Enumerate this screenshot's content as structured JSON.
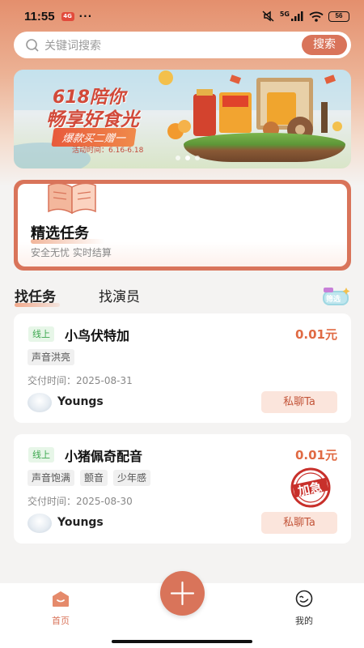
{
  "status_bar": {
    "time": "11:55",
    "app_badge": "4G",
    "dots": "···",
    "network": "5G",
    "battery": "56"
  },
  "search": {
    "placeholder": "关键词搜索",
    "button_label": "搜索"
  },
  "banner": {
    "title_line1": "618陪你",
    "title_line2": "畅享好食光",
    "promo": "爆款买二赠一",
    "date": "活动时间：6.16-6.18",
    "slide_count": 3,
    "active_slide": 1
  },
  "feature_card": {
    "title": "精选任务",
    "subtitle": "安全无忧  实时结算"
  },
  "tabs": [
    {
      "label": "找任务",
      "active": true
    },
    {
      "label": "找演员",
      "active": false
    }
  ],
  "filter_badge": "筛选",
  "tasks": [
    {
      "mode": "线上",
      "title": "小鸟伏特加",
      "price": "0.01元",
      "tags": [
        "声音洪亮"
      ],
      "deliver": "交付时间：2025-08-31",
      "user": "Youngs",
      "action": "私聊Ta",
      "urgent": false
    },
    {
      "mode": "线上",
      "title": "小猪佩奇配音",
      "price": "0.01元",
      "tags": [
        "声音饱满",
        "颤音",
        "少年感"
      ],
      "deliver": "交付时间：2025-08-30",
      "user": "Youngs",
      "action": "私聊Ta",
      "urgent": true,
      "urgent_label": "加急"
    }
  ],
  "bottom_nav": {
    "home_label": "首页",
    "mine_label": "我的"
  },
  "colors": {
    "accent": "#d9745a",
    "price": "#e06a43",
    "online_tag": "#3da84f"
  }
}
